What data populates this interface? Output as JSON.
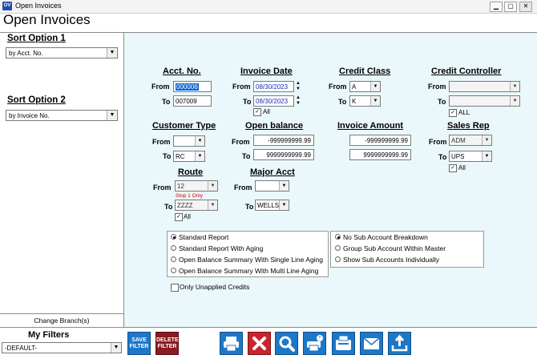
{
  "window": {
    "app_icon": "OV",
    "title": "Open Invoices",
    "minimize": "▁",
    "restore": "▢",
    "close": "✕"
  },
  "page_title": "Open Invoices",
  "sidebar": {
    "sort1_label": "Sort Option 1",
    "sort1_value": "by Acct. No.",
    "sort2_label": "Sort Option 2",
    "sort2_value": "by Invoice No.",
    "change_branch": "Change Branch(s)",
    "my_filters_label": "My Filters",
    "my_filters_value": "-DEFAULT-"
  },
  "filters": {
    "acct_no": {
      "label": "Acct. No.",
      "from_label": "From",
      "from": "000006",
      "to_label": "To",
      "to": "007009"
    },
    "invoice_date": {
      "label": "Invoice Date",
      "from_label": "From",
      "from": "08/30/2023",
      "to_label": "To",
      "to": "08/30/2023",
      "all_label": "All"
    },
    "credit_class": {
      "label": "Credit Class",
      "from_label": "From",
      "from": "A",
      "to_label": "To",
      "to": "K"
    },
    "credit_controller": {
      "label": "Credit Controller",
      "from_label": "From",
      "from": "",
      "to_label": "To",
      "to": "",
      "all_label": "ALL"
    },
    "customer_type": {
      "label": "Customer Type",
      "from_label": "From",
      "from": "",
      "to_label": "To",
      "to": "RC"
    },
    "open_balance": {
      "label": "Open balance",
      "from_label": "From",
      "from": "-999999999.99",
      "to_label": "To",
      "to": "9999999999.99"
    },
    "invoice_amount": {
      "label": "Invoice Amount",
      "from": "-999999999.99",
      "to": "9999999999.99"
    },
    "sales_rep": {
      "label": "Sales Rep",
      "from_label": "From",
      "from": "ADM",
      "to_label": "To",
      "to": "UPS",
      "all_label": "All"
    },
    "route": {
      "label": "Route",
      "from_label": "From",
      "from": "12",
      "note": "Stop 1 Only",
      "to_label": "To",
      "to": "ZZZZ",
      "all_label": "All"
    },
    "major_acct": {
      "label": "Major Acct",
      "from_label": "From",
      "from": "",
      "to_label": "To",
      "to": "WELLS"
    }
  },
  "report_options": [
    "Standard Report",
    "Standard Report With Aging",
    "Open Balance Summary With Single Line Aging",
    "Open Balance Summary With Multi Line Aging"
  ],
  "report_selected": 0,
  "sub_account_options": [
    "No Sub Account Breakdown",
    "Group Sub Account Within Master",
    "Show Sub Accounts Individually"
  ],
  "sub_account_selected": 0,
  "only_unapplied": "Only Unapplied Credits",
  "toolbar": {
    "save_filter_1": "SAVE",
    "save_filter_2": "FILTER",
    "delete_filter_1": "DELETE",
    "delete_filter_2": "FILTER"
  },
  "icons": {
    "print": "print-icon",
    "cancel": "close-icon",
    "preview": "search-icon",
    "print_setup": "print-help-icon",
    "fax": "fax-icon",
    "email": "email-icon",
    "export": "upload-icon"
  },
  "colors": {
    "accent": "#1b78c9",
    "panel_bg": "#eaf8fb",
    "delete": "#8b1a22",
    "cancel": "#c8252d",
    "note": "#d00000"
  }
}
